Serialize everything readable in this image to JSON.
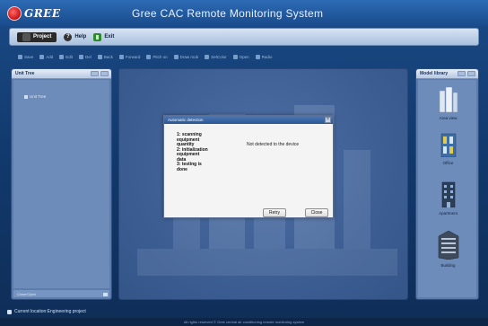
{
  "window": {
    "logo_text": "GREE",
    "title": "Gree CAC Remote Monitoring System"
  },
  "menu": {
    "items": [
      {
        "label": "Project",
        "icon": "project-icon",
        "active": true
      },
      {
        "label": "Help",
        "icon": "help-icon",
        "active": false
      },
      {
        "label": "Exit",
        "icon": "exit-icon",
        "active": false
      }
    ]
  },
  "toolbar": {
    "items": [
      "Save",
      "Add",
      "Edit",
      "Del",
      "Back",
      "Forward",
      "Pitch on",
      "Draw mob",
      "SetColor",
      "Open",
      "Radio"
    ]
  },
  "left_panel": {
    "title": "Unit Tree",
    "tree_root": "Unit Tree",
    "footer_label": "Close/Open"
  },
  "right_panel": {
    "title": "Model library",
    "categories": [
      {
        "label": "Area view",
        "icon": "area-view-building-icon"
      },
      {
        "label": "Office",
        "icon": "office-building-icon"
      },
      {
        "label": "Apartment",
        "icon": "apartment-building-icon"
      },
      {
        "label": "Building",
        "icon": "building-icon"
      }
    ]
  },
  "dialog": {
    "title": "Automatic detection",
    "close_glyph": "×",
    "steps": [
      "1: scanning",
      "equipment",
      "quantity",
      "2: initialization",
      "equipment",
      "data",
      "3: testing is",
      "done"
    ],
    "message": "Not detected to the device",
    "retry_label": "Retry",
    "close_label": "Close"
  },
  "status": {
    "text": "Current location:Engineering project"
  },
  "footer": {
    "text": "All rights reserved © Gree central air conditioning remote monitoring system"
  },
  "colors": {
    "brand_blue": "#184a8a",
    "logo_red": "#d11c1c",
    "dialog_header": "#2b5797"
  }
}
